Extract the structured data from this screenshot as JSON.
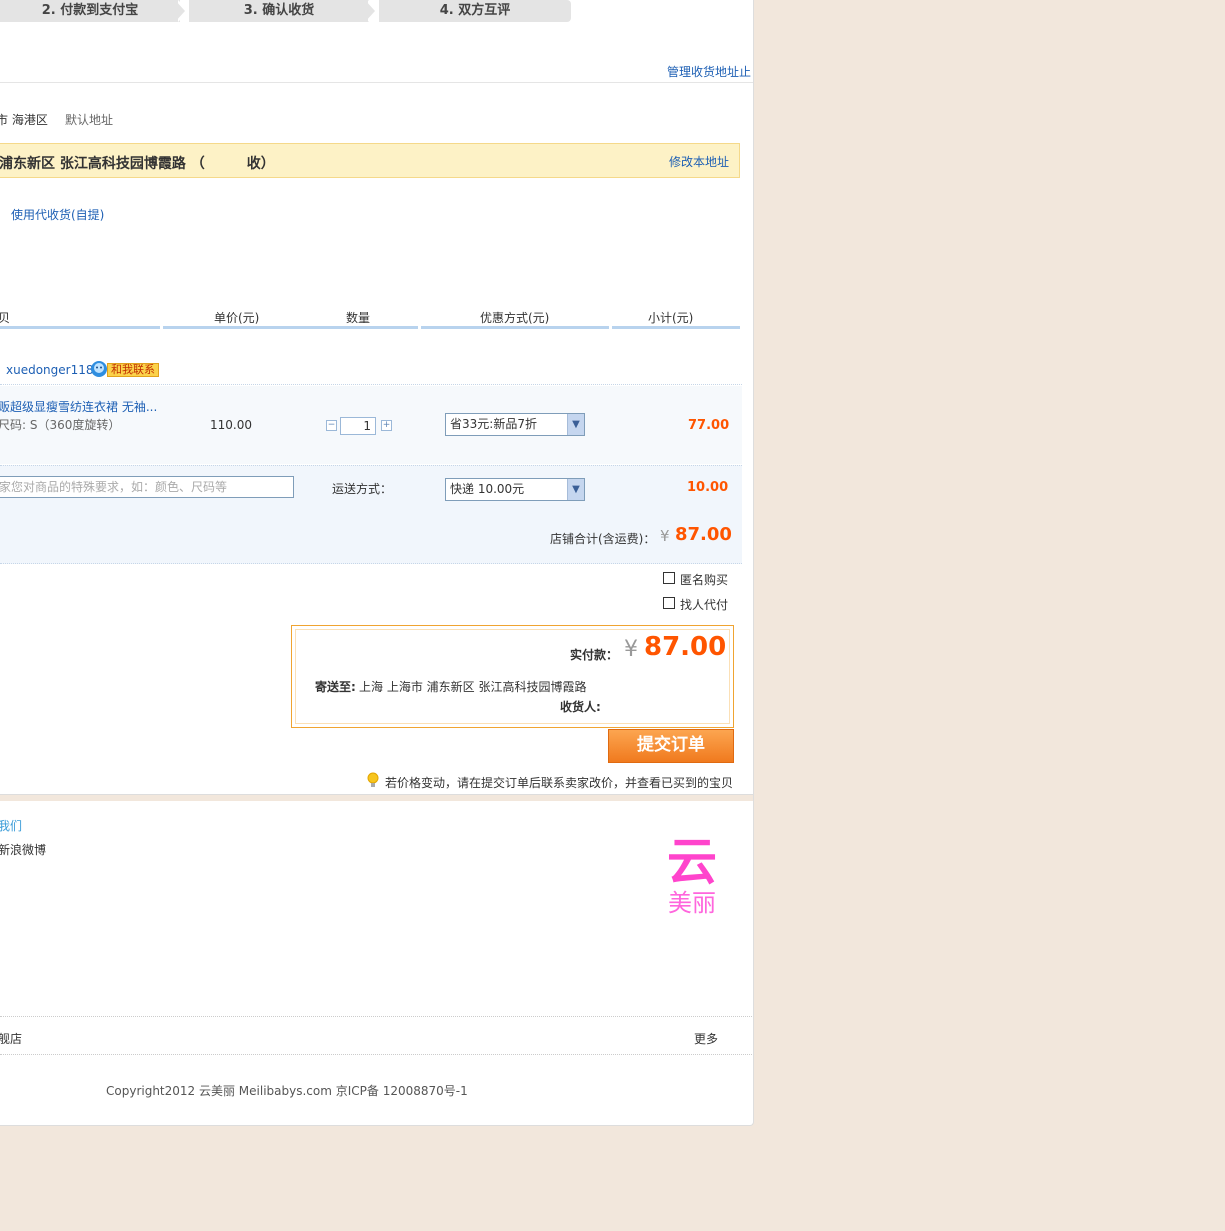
{
  "steps": [
    {
      "label": "2. 付款到支付宝"
    },
    {
      "label": "3. 确认收货"
    },
    {
      "label": "4. 双方互评"
    }
  ],
  "address": {
    "manage_link": "管理收货地址",
    "manage_link_cut": "止",
    "row1_region": "市 海港区",
    "row1_default": "默认地址",
    "selected_text": "浦东新区 张江高科技园博霞路 （　　　收）",
    "edit_link": "修改本地址",
    "pickup_link": "使用代收货(自提)"
  },
  "table": {
    "headers": {
      "item": "贝",
      "price": "单价(元)",
      "qty": "数量",
      "discount": "优惠方式(元)",
      "subtotal": "小计(元)"
    }
  },
  "seller": {
    "name": "xuedonger118",
    "contact_badge": "和我联系"
  },
  "item": {
    "title": "贩超级显瘦雪纺连衣裙 无袖...",
    "spec": "尺码: S（360度旋转）",
    "price": "110.00",
    "qty": "1",
    "qty_minus": "−",
    "qty_plus": "+",
    "discount_option": "省33元:新品7折",
    "subtotal": "77.00"
  },
  "shipping": {
    "note_placeholder": "家您对商品的特殊要求，如：颜色、尺码等",
    "label": "运送方式：",
    "option": "快递 10.00元",
    "fee": "10.00"
  },
  "store_total": {
    "label": "店铺合计(含运费)：",
    "currency": "¥",
    "amount": "87.00"
  },
  "options": {
    "anonymous": "匿名购买",
    "proxy_pay": "找人代付"
  },
  "summary": {
    "pay_label": "实付款：",
    "currency": "¥",
    "amount": "87.00",
    "ship_to_label": "寄送至:",
    "ship_to_value": "上海 上海市 浦东新区 张江高科技园博霞路",
    "receiver_label": "收货人:",
    "receiver_value": ""
  },
  "submit_label": "提交订单",
  "price_tip": "若价格变动，请在提交订单后联系卖家改价，并查看已买到的宝贝",
  "footer": {
    "link1": "我们",
    "link2": "新浪微博",
    "logo_top": "云",
    "logo_bottom": "美丽",
    "store_label": "舰店",
    "more_label": "更多",
    "copyright": "Copyright2012 云美丽 Meilibabys.com 京ICP备 12008870号-1"
  },
  "colors": {
    "accent_orange": "#ff5500",
    "link_blue": "#1d5fb4",
    "logo_pink": "#ff44cc",
    "submit_orange": "#f07a1e",
    "highlight_yellow": "#fdf2c6"
  }
}
